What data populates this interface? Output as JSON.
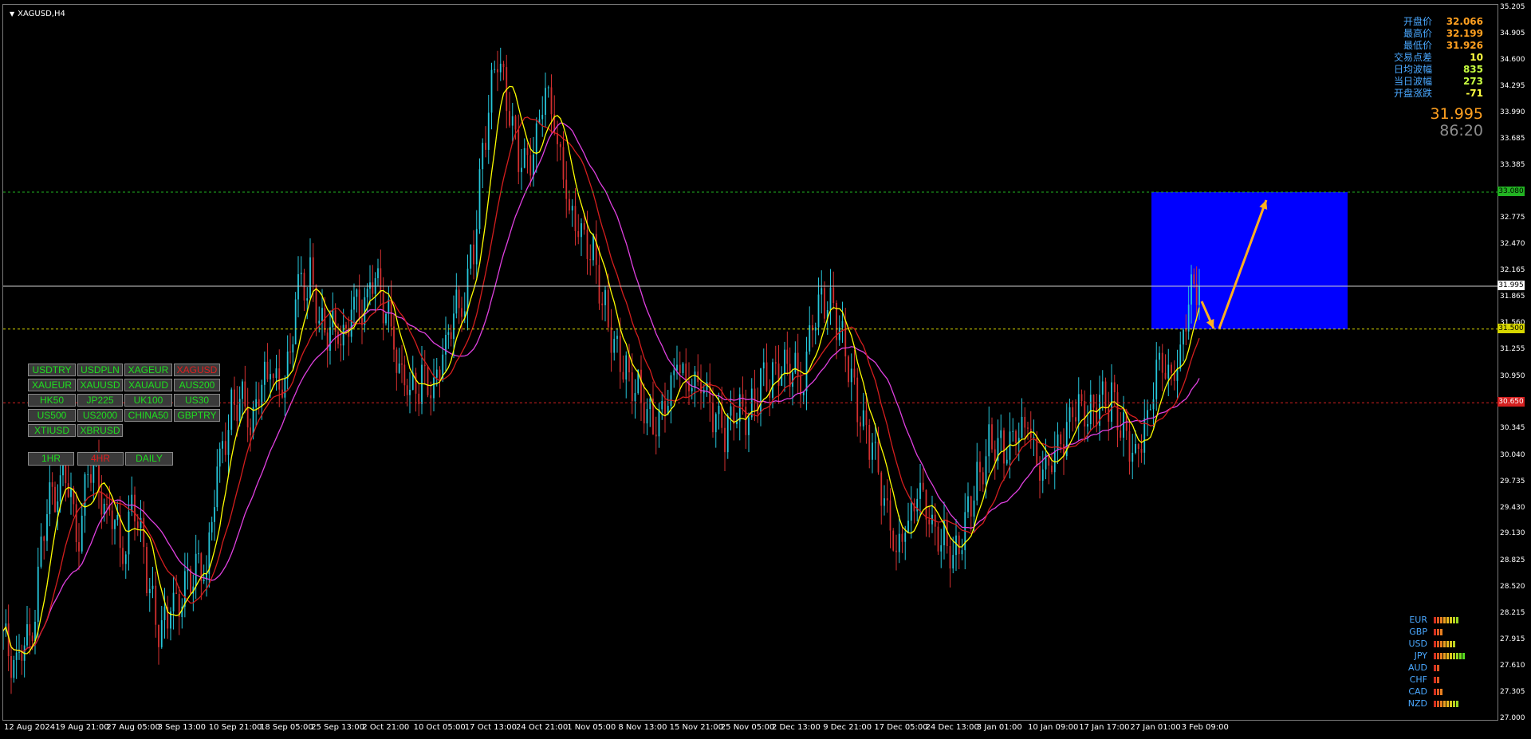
{
  "chart_title": "XAGUSD,H4",
  "symbols": [
    [
      "USDTRY",
      "USDPLN",
      "XAGEUR",
      "XAGUSD"
    ],
    [
      "XAUEUR",
      "XAUUSD",
      "XAUAUD",
      "AUS200"
    ],
    [
      "HK50",
      "JP225",
      "UK100",
      "US30"
    ],
    [
      "US500",
      "US2000",
      "CHINA50",
      "GBPTRY"
    ],
    [
      "XTIUSD",
      "XBRUSD"
    ]
  ],
  "active_symbol": "XAGUSD",
  "timeframes": [
    "1HR",
    "4HR",
    "DAILY"
  ],
  "active_timeframe": "4HR",
  "info_panel": [
    {
      "label": "开盘价",
      "value": "32.066",
      "color": "#ffa020"
    },
    {
      "label": "最高价",
      "value": "32.199",
      "color": "#ffa020"
    },
    {
      "label": "最低价",
      "value": "31.926",
      "color": "#ffa020"
    },
    {
      "label": "交易点差",
      "value": "10",
      "color": "#ffff40"
    },
    {
      "label": "日均波幅",
      "value": "835",
      "color": "#c8ff40"
    },
    {
      "label": "当日波幅",
      "value": "273",
      "color": "#c8ff40"
    },
    {
      "label": "开盘涨跌",
      "value": "-71",
      "color": "#ffff40"
    }
  ],
  "bid_price": "31.995",
  "bar_timer": "86:20",
  "price_tags": {
    "green_level": "33.080",
    "bid": "31.995",
    "yellow_level": "31.500",
    "red_level": "30.650"
  },
  "currency_strength": [
    {
      "currency": "EUR",
      "level": 8
    },
    {
      "currency": "GBP",
      "level": 3
    },
    {
      "currency": "USD",
      "level": 7
    },
    {
      "currency": "JPY",
      "level": 10
    },
    {
      "currency": "AUD",
      "level": 2
    },
    {
      "currency": "CHF",
      "level": 2
    },
    {
      "currency": "CAD",
      "level": 3
    },
    {
      "currency": "NZD",
      "level": 8
    }
  ],
  "colors": {
    "bull": "#26c6da",
    "bear": "#d32f2f",
    "ma_fast": "#ffff00",
    "ma_mid": "#d41e1e",
    "ma_slow": "#e040e0",
    "projection_box": "#0000ff",
    "arrow": "#ffb020",
    "green_line": "#22b322",
    "yellow_line": "#d6d600",
    "red_line": "#d42020",
    "bid_line": "#cfcfcf"
  },
  "chart_data": {
    "type": "candlestick",
    "symbol": "XAGUSD",
    "timeframe": "H4",
    "x_ticks": [
      "12 Aug 2024",
      "19 Aug 21:00",
      "27 Aug 05:00",
      "3 Sep 13:00",
      "10 Sep 21:00",
      "18 Sep 05:00",
      "25 Sep 13:00",
      "2 Oct 21:00",
      "10 Oct 05:00",
      "17 Oct 13:00",
      "24 Oct 21:00",
      "1 Nov 05:00",
      "8 Nov 13:00",
      "15 Nov 21:00",
      "25 Nov 05:00",
      "2 Dec 13:00",
      "9 Dec 21:00",
      "17 Dec 05:00",
      "24 Dec 13:00",
      "3 Jan 01:00",
      "10 Jan 09:00",
      "17 Jan 17:00",
      "27 Jan 01:00",
      "3 Feb 09:00"
    ],
    "y_ticks": [
      "35.205",
      "34.905",
      "34.600",
      "34.295",
      "33.990",
      "33.685",
      "33.385",
      "33.080",
      "32.775",
      "32.470",
      "32.165",
      "31.865",
      "31.560",
      "31.255",
      "30.950",
      "30.650",
      "30.345",
      "30.040",
      "29.735",
      "29.430",
      "29.130",
      "28.825",
      "28.520",
      "28.215",
      "27.915",
      "27.610",
      "27.305",
      "27.000"
    ],
    "ylim": [
      27.0,
      35.205
    ],
    "close_path": [
      {
        "x": "12 Aug 2024",
        "close": 27.9
      },
      {
        "x": "19 Aug 21:00",
        "close": 29.3
      },
      {
        "x": "27 Aug 05:00",
        "close": 29.6
      },
      {
        "x": "3 Sep 13:00",
        "close": 28.0
      },
      {
        "x": "10 Sep 21:00",
        "close": 30.6
      },
      {
        "x": "18 Sep 05:00",
        "close": 31.2
      },
      {
        "x": "25 Sep 13:00",
        "close": 31.8
      },
      {
        "x": "2 Oct 21:00",
        "close": 31.6
      },
      {
        "x": "10 Oct 05:00",
        "close": 30.9
      },
      {
        "x": "17 Oct 13:00",
        "close": 31.8
      },
      {
        "x": "24 Oct 21:00",
        "close": 34.4
      },
      {
        "x": "1 Nov 05:00",
        "close": 32.7
      },
      {
        "x": "8 Nov 13:00",
        "close": 30.5
      },
      {
        "x": "15 Nov 21:00",
        "close": 31.0
      },
      {
        "x": "25 Nov 05:00",
        "close": 30.2
      },
      {
        "x": "2 Dec 13:00",
        "close": 31.0
      },
      {
        "x": "9 Dec 21:00",
        "close": 31.9
      },
      {
        "x": "17 Dec 05:00",
        "close": 29.5
      },
      {
        "x": "24 Dec 13:00",
        "close": 29.2
      },
      {
        "x": "3 Jan 01:00",
        "close": 29.6
      },
      {
        "x": "10 Jan 09:00",
        "close": 30.2
      },
      {
        "x": "17 Jan 17:00",
        "close": 30.6
      },
      {
        "x": "27 Jan 01:00",
        "close": 30.6
      },
      {
        "x": "3 Feb 09:00",
        "close": 31.995
      }
    ],
    "horizontal_levels": [
      33.08,
      31.995,
      31.5,
      30.65
    ],
    "projection_box": {
      "top": 33.08,
      "bottom": 31.5
    },
    "grid": false
  }
}
